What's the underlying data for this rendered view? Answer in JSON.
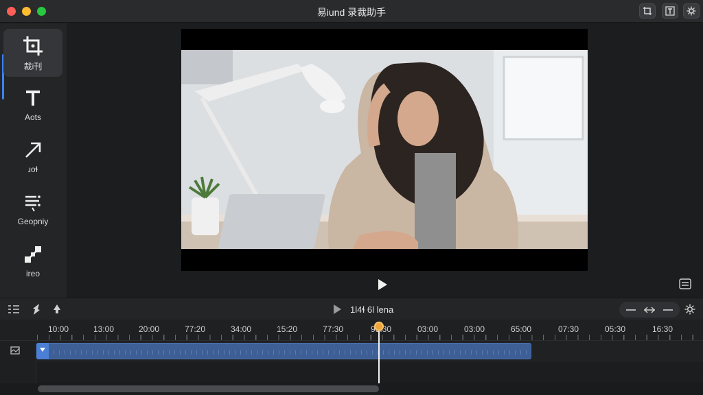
{
  "window": {
    "title": "易iund 录裁助手"
  },
  "titlebar_buttons": [
    {
      "icon": "crop-frame-icon"
    },
    {
      "icon": "text-box-icon"
    },
    {
      "icon": "settings-gear-icon"
    }
  ],
  "sidebar": {
    "items": [
      {
        "label": "裁i刊",
        "icon": "crop-icon",
        "active": true
      },
      {
        "label": "Aots",
        "icon": "text-icon"
      },
      {
        "label": "ɹoɬ",
        "icon": "arrow-icon"
      },
      {
        "label": "Geopniy",
        "icon": "list-filter-icon"
      },
      {
        "label": "ireo",
        "icon": "resize-icon"
      }
    ]
  },
  "player": {
    "play_icon": "play-icon",
    "fullscreen_icon": "fullscreen-icon"
  },
  "transport": {
    "left_icons": [
      "tracks-icon",
      "marker-icon",
      "split-icon"
    ],
    "play_icon": "play-icon",
    "time_label": "1l4ɬ 6l lena",
    "zoom_icons": [
      "zoom-out-icon",
      "zoom-fit-icon",
      "zoom-in-icon"
    ]
  },
  "timeline": {
    "ruler_labels": [
      "10:00",
      "13:00",
      "20:00",
      "77:20",
      "34:00",
      "15:20",
      "77:30",
      "93:30",
      "03:00",
      "03:00",
      "65:00",
      "07:30",
      "05:30",
      "16:30"
    ],
    "playhead_position": 0.51
  },
  "colors": {
    "accent": "#3b82f6",
    "clip": "#3d5f96",
    "playhead": "#f0a53a"
  }
}
